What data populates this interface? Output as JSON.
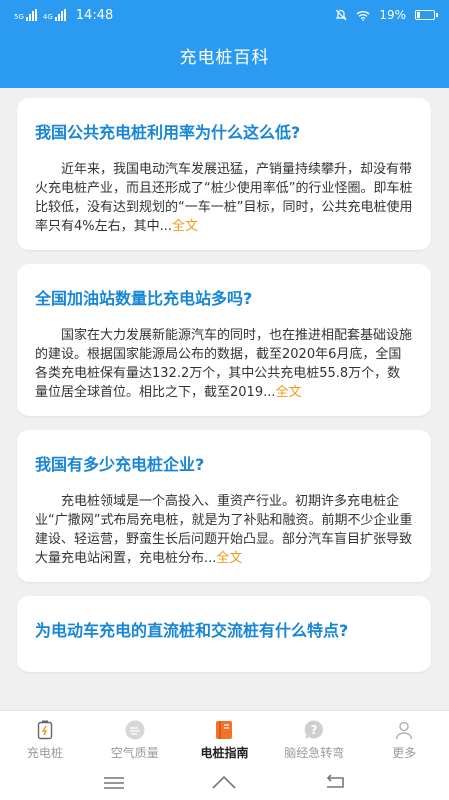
{
  "status_bar": {
    "network_1": "5G",
    "network_2": "4G",
    "time": "14:48",
    "battery_percent": "19%"
  },
  "header": {
    "title": "充电桩百科"
  },
  "articles": [
    {
      "title": "我国公共充电桩利用率为什么这么低?",
      "body": "近年来，我国电动汽车发展迅猛，产销量持续攀升，却没有带火充电桩产业，而且还形成了“桩少使用率低”的行业怪圈。即车桩比较低，没有达到规划的“一车一桩”目标，同时，公共充电桩使用率只有4%左右，其中...",
      "more": "全文"
    },
    {
      "title": "全国加油站数量比充电站多吗?",
      "body": "国家在大力发展新能源汽车的同时，也在推进相配套基础设施的建设。根据国家能源局公布的数据，截至2020年6月底，全国各类充电桩保有量达132.2万个，其中公共充电桩55.8万个，数量位居全球首位。相比之下，截至2019...",
      "more": "全文"
    },
    {
      "title": "我国有多少充电桩企业?",
      "body": "充电桩领域是一个高投入、重资产行业。初期许多充电桩企业“广撒网”式布局充电桩，就是为了补贴和融资。前期不少企业重建设、轻运营，野蛮生长后问题开始凸显。部分汽车盲目扩张导致大量充电站闲置，充电桩分布...",
      "more": "全文"
    },
    {
      "title": "为电动车充电的直流桩和交流桩有什么特点?",
      "body": "",
      "more": ""
    }
  ],
  "tabbar": {
    "active_index": 2,
    "items": [
      {
        "label": "充电桩",
        "icon": "charging-pile-icon"
      },
      {
        "label": "空气质量",
        "icon": "air-quality-icon"
      },
      {
        "label": "电桩指南",
        "icon": "book-icon"
      },
      {
        "label": "脑经急转弯",
        "icon": "question-bubble-icon"
      },
      {
        "label": "更多",
        "icon": "person-icon"
      }
    ]
  },
  "colors": {
    "header_bg": "#2a9bf0",
    "title_blue": "#1786d6",
    "more_orange": "#f09a1a",
    "page_bg": "#f0f0f0"
  }
}
